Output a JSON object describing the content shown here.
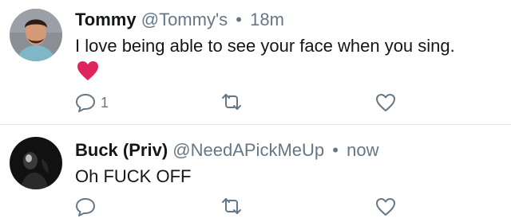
{
  "colors": {
    "text_primary": "#14171a",
    "text_secondary": "#657786",
    "divider": "#e1e8ed",
    "heart": "#e0245e"
  },
  "tweets": [
    {
      "name": "Tommy",
      "handle": "@Tommy's",
      "separator": "•",
      "time": "18m",
      "text": "I love being able to see your face when you sing.",
      "emoji": "red-heart-emoji",
      "actions": {
        "reply_icon": "reply-icon",
        "reply_count": "1",
        "retweet_icon": "retweet-icon",
        "like_icon": "like-heart-icon"
      }
    },
    {
      "name": "Buck (Priv)",
      "handle": "@NeedAPickMeUp",
      "separator": "•",
      "time": "now",
      "text": "Oh FUCK OFF",
      "actions": {
        "reply_icon": "reply-icon",
        "retweet_icon": "retweet-icon",
        "like_icon": "like-heart-icon"
      }
    }
  ]
}
